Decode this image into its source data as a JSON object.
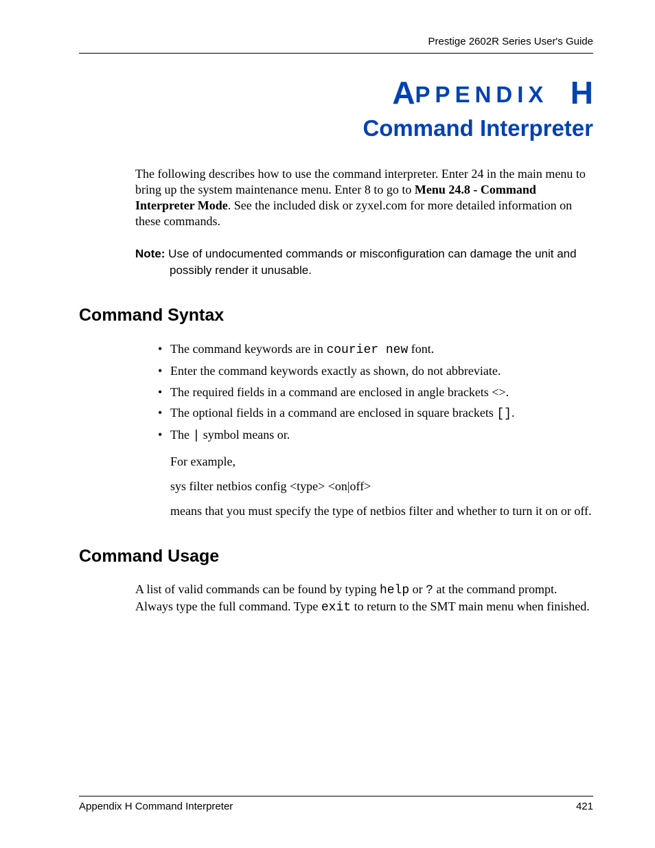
{
  "header": {
    "running": "Prestige 2602R Series User's Guide"
  },
  "appendix": {
    "big_a": "A",
    "ppendix": "PPENDIX",
    "big_h": "H",
    "title": "Command Interpreter"
  },
  "intro": {
    "pre": "The following describes how to use the command interpreter. Enter 24 in the main menu to bring up the system maintenance menu. Enter 8 to go to ",
    "bold": "Menu 24.8 - Command Interpreter Mode",
    "post": ". See the included disk or zyxel.com for more detailed information on these commands."
  },
  "note": {
    "label": "Note:",
    "text": " Use of undocumented commands or misconfiguration can damage the unit and possibly render it unusable."
  },
  "syntax": {
    "heading": "Command Syntax",
    "items": [
      {
        "pre": "The command keywords are in ",
        "mono": "courier new",
        "post": " font."
      },
      {
        "full": "Enter the command keywords exactly as shown, do not abbreviate."
      },
      {
        "full": "The required fields in a command are enclosed in angle brackets <>."
      },
      {
        "pre": "The optional fields in a command are enclosed in square brackets ",
        "mono": "[]",
        "post": "."
      },
      {
        "pre": "The ",
        "mono": "|",
        "post": " symbol means or.",
        "sub1": "For example,",
        "sub2": "sys filter netbios config <type> <on|off>",
        "sub3": "means that you must specify the type of netbios filter and whether to turn it on or off."
      }
    ]
  },
  "usage": {
    "heading": "Command Usage",
    "pre": "A list of valid commands can be found by typing ",
    "mono1": "help",
    "mid1": " or ",
    "mono2": "?",
    "mid2": " at the command prompt. Always type the full command. Type ",
    "mono3": "exit",
    "post": " to return to the SMT main menu when finished."
  },
  "footer": {
    "left": "Appendix H Command Interpreter",
    "right": "421"
  }
}
